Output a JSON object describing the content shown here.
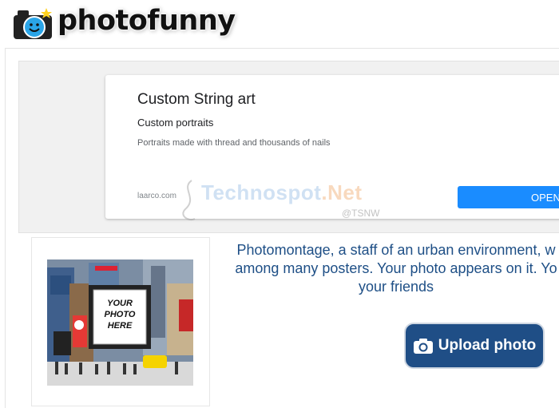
{
  "header": {
    "logo_text": "photofunny"
  },
  "ad": {
    "title": "Custom String art",
    "subtitle": "Custom portraits",
    "description": "Portraits made with thread and thousands of nails",
    "domain": "laarco.com",
    "button_label": "OPEN"
  },
  "watermark": {
    "text_main": "Technospot",
    "text_suffix": ".Net",
    "handle": "@TSNW"
  },
  "effect": {
    "billboard_text": [
      "YOUR",
      "PHOTO",
      "HERE"
    ],
    "description": "Photomontage, a staff of an urban environment, w\namong many posters. Your photo appears on it. Yo\nyour friends",
    "upload_label": "Upload photo"
  },
  "icons": {
    "logo": "camera-smiley-icon",
    "upload": "camera-icon"
  },
  "colors": {
    "accent_blue": "#1a8cff",
    "desc_text": "#1e4f86",
    "upload_bg": "#1f4e86"
  }
}
